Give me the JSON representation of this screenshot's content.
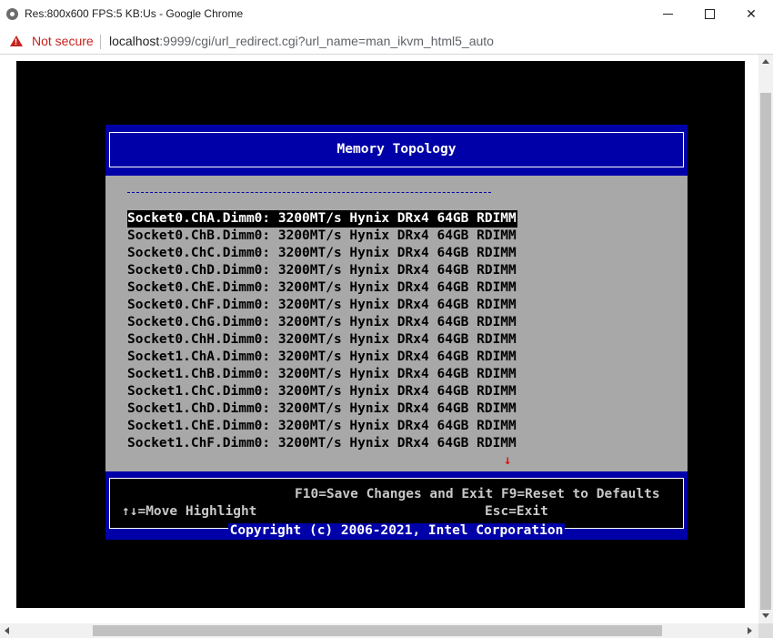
{
  "window": {
    "title": "Res:800x600 FPS:5 KB:Us - Google Chrome",
    "minimize_glyph": "",
    "close_glyph": "✕"
  },
  "addressbar": {
    "security_label": "Not secure",
    "url_host": "localhost",
    "url_rest": ":9999/cgi/url_redirect.cgi?url_name=man_ikvm_html5_auto"
  },
  "bios": {
    "title": "Memory Topology",
    "divider": "",
    "dimms": [
      "Socket0.ChA.Dimm0: 3200MT/s Hynix DRx4 64GB RDIMM",
      "Socket0.ChB.Dimm0: 3200MT/s Hynix DRx4 64GB RDIMM",
      "Socket0.ChC.Dimm0: 3200MT/s Hynix DRx4 64GB RDIMM",
      "Socket0.ChD.Dimm0: 3200MT/s Hynix DRx4 64GB RDIMM",
      "Socket0.ChE.Dimm0: 3200MT/s Hynix DRx4 64GB RDIMM",
      "Socket0.ChF.Dimm0: 3200MT/s Hynix DRx4 64GB RDIMM",
      "Socket0.ChG.Dimm0: 3200MT/s Hynix DRx4 64GB RDIMM",
      "Socket0.ChH.Dimm0: 3200MT/s Hynix DRx4 64GB RDIMM",
      "Socket1.ChA.Dimm0: 3200MT/s Hynix DRx4 64GB RDIMM",
      "Socket1.ChB.Dimm0: 3200MT/s Hynix DRx4 64GB RDIMM",
      "Socket1.ChC.Dimm0: 3200MT/s Hynix DRx4 64GB RDIMM",
      "Socket1.ChD.Dimm0: 3200MT/s Hynix DRx4 64GB RDIMM",
      "Socket1.ChE.Dimm0: 3200MT/s Hynix DRx4 64GB RDIMM",
      "Socket1.ChF.Dimm0: 3200MT/s Hynix DRx4 64GB RDIMM"
    ],
    "scroll_indicator": "↓",
    "help": {
      "save_reset": "F10=Save Changes and Exit F9=Reset to Defaults",
      "move": "↑↓=Move Highlight",
      "exit": "Esc=Exit"
    },
    "copyright": "Copyright (c) 2006-2021, Intel Corporation"
  },
  "colors": {
    "bios_blue": "#0000a8",
    "bios_gray": "#a8a8a8",
    "warning_red": "#c5221f"
  }
}
